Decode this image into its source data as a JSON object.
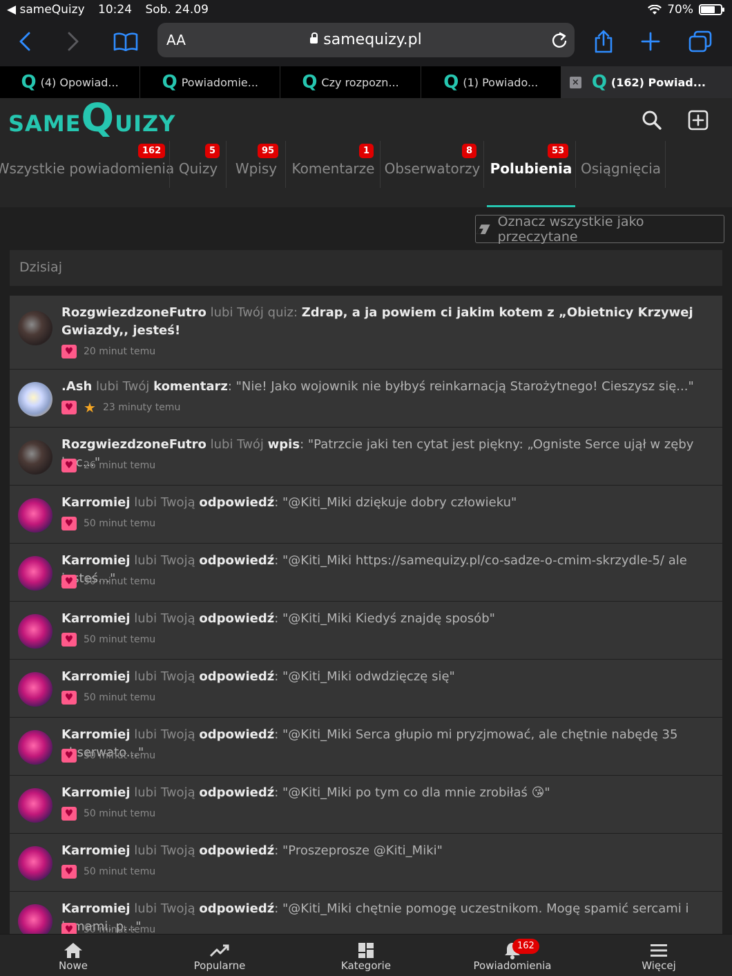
{
  "status_bar": {
    "back_app": "sameQuizy",
    "time": "10:24",
    "date": "Sob. 24.09",
    "battery": "70%"
  },
  "browser": {
    "text_size_label": "AA",
    "url": "samequizy.pl"
  },
  "tabs": [
    {
      "label": "(4) Opowiad..."
    },
    {
      "label": "Powiadomie..."
    },
    {
      "label": "Czy rozpozn..."
    },
    {
      "label": "(1) Powiado..."
    },
    {
      "label": "(162) Powiad..."
    }
  ],
  "tab_close_glyph": "×",
  "logo": {
    "part1": "SAME",
    "part2": "Q",
    "part3": "UIZY"
  },
  "categories": [
    {
      "label": "Wszystkie powiadomienia",
      "badge": "162"
    },
    {
      "label": "Quizy",
      "badge": "5"
    },
    {
      "label": "Wpisy",
      "badge": "95"
    },
    {
      "label": "Komentarze",
      "badge": "1"
    },
    {
      "label": "Obserwatorzy",
      "badge": "8"
    },
    {
      "label": "Polubienia",
      "badge": "53"
    },
    {
      "label": "Osiągnięcia",
      "badge": ""
    }
  ],
  "mark_all_label": "Oznacz wszystkie jako przeczytane",
  "day_label": "Dzisiaj",
  "notifications": [
    {
      "user": "RozgwiezdzoneFutro",
      "verb": "lubi Twój quiz:",
      "object": "Zdrap, a ja powiem ci jakim kotem z „Obietnicy Krzywej Gwiazdy,, jesteś!",
      "quote": "",
      "time": "20 minut temu"
    },
    {
      "user": ".Ash",
      "verb": "lubi Twój",
      "object": "komentarz",
      "quote": ": \"Nie! Jako wojownik nie byłbyś reinkarnacją Starożytnego! Cieszysz się...\"",
      "time": "23 minuty temu"
    },
    {
      "user": "RozgwiezdzoneFutro",
      "verb": "lubi Twój",
      "object": "wpis",
      "quote": ": \"Patrzcie jaki ten cytat jest piękny: „Ogniste Serce ujął w zęby koc...\"",
      "time": "26 minut temu"
    },
    {
      "user": "Karromiej",
      "verb": "lubi Twoją",
      "object": "odpowiedź",
      "quote": ": \"@Kiti_Miki dziękuje dobry człowieku\"",
      "time": "50 minut temu"
    },
    {
      "user": "Karromiej",
      "verb": "lubi Twoją",
      "object": "odpowiedź",
      "quote": ": \"@Kiti_Miki https://samequizy.pl/co-sadze-o-cmim-skrzydle-5/ ale jesteś...\"",
      "time": "50 minut temu"
    },
    {
      "user": "Karromiej",
      "verb": "lubi Twoją",
      "object": "odpowiedź",
      "quote": ": \"@Kiti_Miki Kiedyś znajdę sposób\"",
      "time": "50 minut temu"
    },
    {
      "user": "Karromiej",
      "verb": "lubi Twoją",
      "object": "odpowiedź",
      "quote": ": \"@Kiti_Miki odwdzięczę się\"",
      "time": "50 minut temu"
    },
    {
      "user": "Karromiej",
      "verb": "lubi Twoją",
      "object": "odpowiedź",
      "quote": ": \"@Kiti_Miki Serca głupio mi pryzjmować, ale chętnie nabędę 35 obserwato...\"",
      "time": "50 minut temu"
    },
    {
      "user": "Karromiej",
      "verb": "lubi Twoją",
      "object": "odpowiedź",
      "quote": ": \"@Kiti_Miki po tym co dla mnie zrobiłaś 😘\"",
      "time": "50 minut temu"
    },
    {
      "user": "Karromiej",
      "verb": "lubi Twoją",
      "object": "odpowiedź",
      "quote": ": \"Proszeprosze @Kiti_Miki\"",
      "time": "50 minut temu"
    },
    {
      "user": "Karromiej",
      "verb": "lubi Twoją",
      "object": "odpowiedź",
      "quote": ": \"@Kiti_Miki chętnie pomogę uczestnikom. Mogę spamić sercami i łomami, p...\"",
      "time": "50 minut temu"
    }
  ],
  "bottom_nav": [
    {
      "label": "Nowe",
      "icon": "home-icon"
    },
    {
      "label": "Popularne",
      "icon": "trending-icon"
    },
    {
      "label": "Kategorie",
      "icon": "grid-icon"
    },
    {
      "label": "Powiadomienia",
      "icon": "bell-icon",
      "badge": "162"
    },
    {
      "label": "Więcej",
      "icon": "menu-icon"
    }
  ],
  "colors": {
    "accent": "#26c6b0",
    "badge": "#e00000",
    "heart": "#ff5a8a",
    "star": "#f5a623"
  }
}
